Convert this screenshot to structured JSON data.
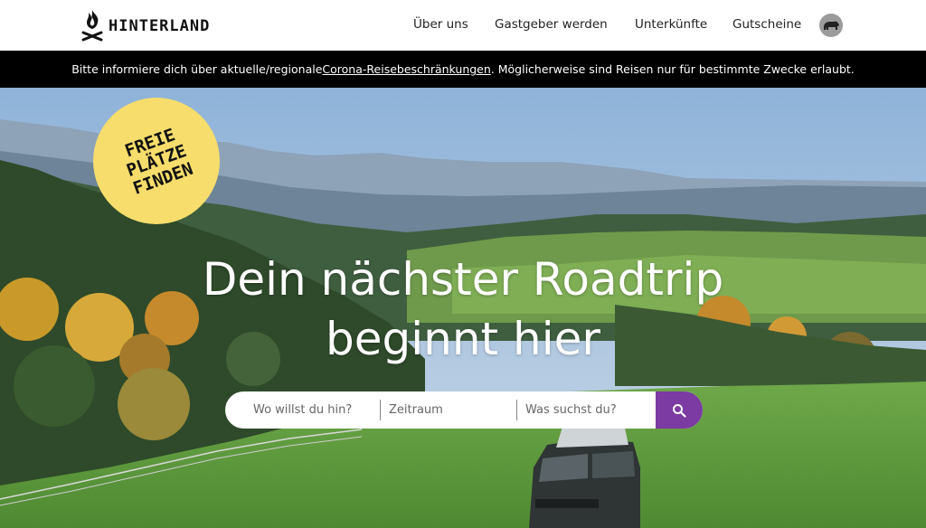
{
  "brand": {
    "name": "HINTERLAND",
    "logo_icon": "campfire-icon"
  },
  "nav": {
    "items": [
      {
        "label": "Über uns"
      },
      {
        "label": "Gastgeber werden"
      },
      {
        "label": "Unterkünfte"
      },
      {
        "label": "Gutscheine"
      }
    ],
    "avatar_icon": "bear-icon"
  },
  "notice": {
    "before": "Bitte informiere dich über aktuelle/regionale ",
    "link": "Corona-Reisebeschränkungen",
    "after": ". Möglicherweise sind Reisen nur für bestimmte Zwecke erlaubt."
  },
  "hero": {
    "badge_line1": "FREIE",
    "badge_line2": "PLÄTZE",
    "badge_line3": "FINDEN",
    "headline_line1": "Dein nächster Roadtrip",
    "headline_line2": "beginnt hier"
  },
  "search": {
    "where_placeholder": "Wo willst du hin?",
    "when_placeholder": "Zeitraum",
    "what_placeholder": "Was suchst du?",
    "button_icon": "search-icon"
  },
  "colors": {
    "accent": "#7c3aa3",
    "badge": "#f7dd6b",
    "notice_bg": "#000000"
  }
}
